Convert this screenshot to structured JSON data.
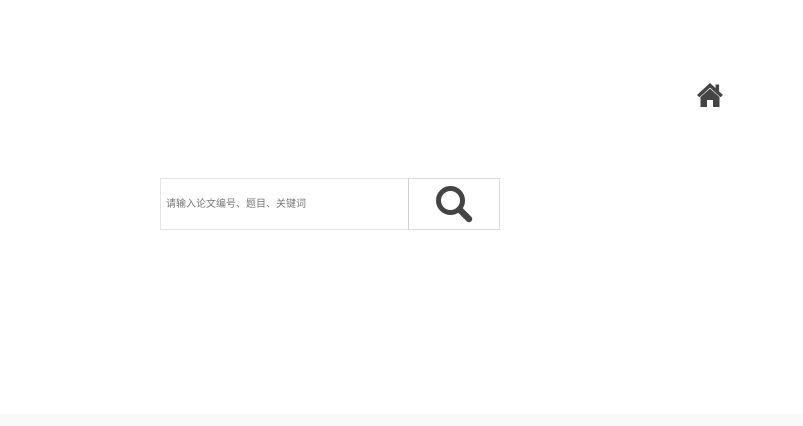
{
  "header": {
    "home_icon": "home-icon"
  },
  "search": {
    "placeholder": "请输入论文编号、题目、关键词",
    "value": "",
    "button_icon": "search-icon"
  },
  "colors": {
    "icon": "#444444",
    "input_border": "#e3e3e3",
    "button_border": "#dcdcdc",
    "placeholder": "#777777",
    "bottom_band": "#f9f9f9"
  }
}
